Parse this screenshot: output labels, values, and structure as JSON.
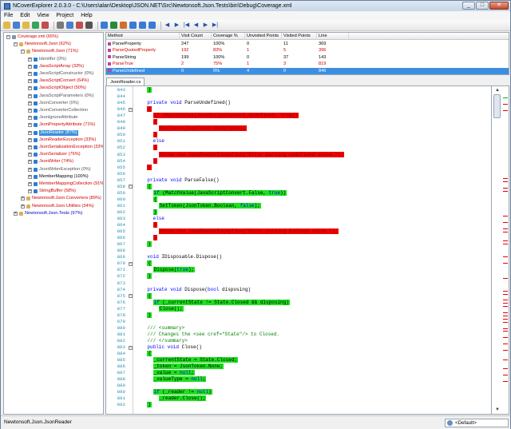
{
  "window": {
    "title": "NCoverExplorer 2.0.3.0 - C:\\Users\\alan\\Desktop\\JSON.NET\\Src\\Newtonsoft.Json.Tests\\bin\\Debug\\Coverage.xml",
    "minimize": "_",
    "maximize": "□",
    "close": "✕"
  },
  "menu": [
    "File",
    "Edit",
    "View",
    "Project",
    "Help"
  ],
  "toolbar": {
    "icons": [
      "open-icon",
      "save-icon",
      "folder-icon",
      "refresh-icon",
      "palette-icon",
      "find-icon",
      "filter-icon",
      "exclude-icon",
      "settings-icon",
      "coverage-icon",
      "report-icon",
      "html-icon",
      "grid-icon",
      "list-icon",
      "tree-icon",
      "back-icon",
      "forward-icon",
      "first-icon",
      "prev-icon",
      "next-icon",
      "last-icon"
    ]
  },
  "tree": [
    {
      "label": "Coverage.xml (65%)",
      "color": "red",
      "icon": "file",
      "level": 0,
      "expander": "−"
    },
    {
      "label": "Newtonsoft.Json (62%)",
      "color": "red",
      "icon": "ns",
      "level": 1,
      "expander": "−"
    },
    {
      "label": "Newtonsoft.Json (71%)",
      "color": "red",
      "icon": "ns",
      "level": 2,
      "expander": "−"
    },
    {
      "label": "IdentIfer (0%)",
      "color": "gray",
      "icon": "cls",
      "level": 3,
      "expander": "+"
    },
    {
      "label": "JavaScriptArray (33%)",
      "color": "red",
      "icon": "cls",
      "level": 3,
      "expander": "+"
    },
    {
      "label": "JavaScriptConstructor (0%)",
      "color": "gray",
      "icon": "cls",
      "level": 3,
      "expander": "+"
    },
    {
      "label": "JavaScriptConvert (64%)",
      "color": "red",
      "icon": "cls",
      "level": 3,
      "expander": "+"
    },
    {
      "label": "JavaScriptObject (50%)",
      "color": "red",
      "icon": "cls",
      "level": 3,
      "expander": "+"
    },
    {
      "label": "JavaScriptParameters (0%)",
      "color": "gray",
      "icon": "cls",
      "level": 3,
      "expander": "+"
    },
    {
      "label": "JsonConverter (0%)",
      "color": "gray",
      "icon": "cls",
      "level": 3,
      "expander": "+"
    },
    {
      "label": "JsonConverterCollection",
      "color": "gray",
      "icon": "cls",
      "level": 3,
      "expander": "+"
    },
    {
      "label": "JsonIgnoreAttribute",
      "color": "gray",
      "icon": "cls",
      "level": 3,
      "expander": "+"
    },
    {
      "label": "JsonPropertyAttribute (71%)",
      "color": "red",
      "icon": "cls",
      "level": 3,
      "expander": "+"
    },
    {
      "label": "JsonReader (87%)",
      "color": "red",
      "icon": "cls",
      "level": 3,
      "expander": "+",
      "selected": true
    },
    {
      "label": "JsonReaderException (33%)",
      "color": "red",
      "icon": "cls",
      "level": 3,
      "expander": "+"
    },
    {
      "label": "JsonSerializationException (33%)",
      "color": "red",
      "icon": "cls",
      "level": 3,
      "expander": "+"
    },
    {
      "label": "JsonSerializer (76%)",
      "color": "red",
      "icon": "cls",
      "level": 3,
      "expander": "+"
    },
    {
      "label": "JsonWriter (74%)",
      "color": "red",
      "icon": "cls",
      "level": 3,
      "expander": "+"
    },
    {
      "label": "JsonWriterException (0%)",
      "color": "gray",
      "icon": "cls",
      "level": 3,
      "expander": "+"
    },
    {
      "label": "MemberMapping (100%)",
      "color": "dark",
      "icon": "cls",
      "level": 3,
      "expander": "+"
    },
    {
      "label": "MemberMappingCollection (91%)",
      "color": "red",
      "icon": "cls",
      "level": 3,
      "expander": "+"
    },
    {
      "label": "StringBuffer (58%)",
      "color": "red",
      "icon": "cls",
      "level": 3,
      "expander": "+"
    },
    {
      "label": "Newtonsoft.Json.Converters (89%)",
      "color": "red",
      "icon": "ns",
      "level": 2,
      "expander": "+"
    },
    {
      "label": "Newtonsoft.Json.Utilities (34%)",
      "color": "red",
      "icon": "ns",
      "level": 2,
      "expander": "+"
    },
    {
      "label": "Newtonsoft.Json.Tests (97%)",
      "color": "blue",
      "icon": "ns",
      "level": 1,
      "expander": "+"
    }
  ],
  "methods": {
    "columns": [
      "Method",
      "Visit Count",
      "Coverage %",
      "Unvisited Points",
      "Visited Points",
      "Line"
    ],
    "rows": [
      {
        "cells": [
          "ParseProperty",
          "247",
          "100%",
          "0",
          "11",
          "369"
        ],
        "color": "dark"
      },
      {
        "cells": [
          "ParseQuotedProperty",
          "192",
          "83%",
          "1",
          "5",
          "396"
        ],
        "color": "red"
      },
      {
        "cells": [
          "ParseString",
          "199",
          "100%",
          "0",
          "37",
          "143"
        ],
        "color": "dark"
      },
      {
        "cells": [
          "ParseTrue",
          "2",
          "75%",
          "1",
          "3",
          "819"
        ],
        "color": "red"
      },
      {
        "cells": [
          "ParseUndefined",
          "0",
          "0%",
          "4",
          "0",
          "846"
        ],
        "color": "dark",
        "selected": true
      }
    ]
  },
  "editor": {
    "tab": "JsonReader.cs",
    "lines": [
      {
        "n": "843",
        "html": "    <span class=\"hl g\">}</span>"
      },
      {
        "n": "844",
        "html": ""
      },
      {
        "n": "845",
        "html": "    <span class=\"kw\">private void</span> ParseUndefined()"
      },
      {
        "n": "846",
        "html": "    <span class=\"hl r\">{</span>",
        "fold": "−"
      },
      {
        "n": "847",
        "html": "      <span class=\"hl r\"><span class=\"kw\">if</span> (MatchValue(JavaScriptConvert.Undefined, <span class=\"kw\">true</span>))</span>"
      },
      {
        "n": "848",
        "html": "      <span class=\"hl r\">{</span>"
      },
      {
        "n": "849",
        "html": "        <span class=\"hl r\">SetToken(JsonToken.Undefined);</span>"
      },
      {
        "n": "850",
        "html": "      <span class=\"hl r\">}</span>"
      },
      {
        "n": "851",
        "html": "      <span class=\"kw\">else</span>"
      },
      {
        "n": "852",
        "html": "      <span class=\"hl r\">{</span>"
      },
      {
        "n": "853",
        "html": "        <span class=\"hl r\"><span class=\"kw\">throw new</span> JsonReaderException(\"Error parsing undefined value.\");</span>"
      },
      {
        "n": "854",
        "html": "      <span class=\"hl r\">}</span>"
      },
      {
        "n": "855",
        "html": "    <span class=\"hl r\">}</span>"
      },
      {
        "n": "856",
        "html": ""
      },
      {
        "n": "857",
        "html": "    <span class=\"kw\">private void</span> ParseFalse()"
      },
      {
        "n": "858",
        "html": "    <span class=\"hl g\">{</span>",
        "fold": "−"
      },
      {
        "n": "859",
        "html": "      <span class=\"hl g\"><span class=\"kw\">if</span> (MatchValue(JavaScriptConvert.False, <span class=\"kw\">true</span>))</span>"
      },
      {
        "n": "860",
        "html": "      <span class=\"hl g\">{</span>"
      },
      {
        "n": "861",
        "html": "        <span class=\"hl g\">SetToken(JsonToken.Boolean, <span class=\"kw\">false</span>);</span>"
      },
      {
        "n": "862",
        "html": "      <span class=\"hl g\">}</span>"
      },
      {
        "n": "863",
        "html": "      <span class=\"kw\">else</span>"
      },
      {
        "n": "864",
        "html": "      <span class=\"hl r\">{</span>"
      },
      {
        "n": "865",
        "html": "        <span class=\"hl r\"><span class=\"kw\">throw new</span> JsonReaderException(\"Error parsing boolean value.\");</span>"
      },
      {
        "n": "866",
        "html": "      <span class=\"hl r\">}</span>"
      },
      {
        "n": "867",
        "html": "    <span class=\"hl g\">}</span>"
      },
      {
        "n": "868",
        "html": ""
      },
      {
        "n": "869",
        "html": "    <span class=\"kw\">void</span> IDisposable.Dispose()"
      },
      {
        "n": "870",
        "html": "    <span class=\"hl g\">{</span>",
        "fold": "−"
      },
      {
        "n": "871",
        "html": "      <span class=\"hl g\">Dispose(<span class=\"kw\">true</span>);</span>"
      },
      {
        "n": "872",
        "html": "    <span class=\"hl g\">}</span>"
      },
      {
        "n": "873",
        "html": ""
      },
      {
        "n": "874",
        "html": "    <span class=\"kw\">private void</span> Dispose(<span class=\"kw\">bool</span> disposing)"
      },
      {
        "n": "875",
        "html": "    <span class=\"hl g\">{</span>",
        "fold": "−"
      },
      {
        "n": "876",
        "html": "      <span class=\"hl g\"><span class=\"kw\">if</span> (_currentState != State.Closed &amp;&amp; disposing)</span>"
      },
      {
        "n": "877",
        "html": "        <span class=\"hl g\">Close();</span>"
      },
      {
        "n": "878",
        "html": "    <span class=\"hl g\">}</span>"
      },
      {
        "n": "879",
        "html": ""
      },
      {
        "n": "880",
        "html": "    <span class=\"cm\">/// &lt;summary&gt;</span>"
      },
      {
        "n": "881",
        "html": "    <span class=\"cm\">/// Changes the &lt;see cref=\"State\"/&gt; to Closed.</span>"
      },
      {
        "n": "882",
        "html": "    <span class=\"cm\">/// &lt;/summary&gt;</span>"
      },
      {
        "n": "883",
        "html": "    <span class=\"kw\">public void</span> Close()",
        "fold": "−"
      },
      {
        "n": "884",
        "html": "    <span class=\"hl g\">{</span>"
      },
      {
        "n": "885",
        "html": "      <span class=\"hl g\">_currentState = State.Closed;</span>"
      },
      {
        "n": "886",
        "html": "      <span class=\"hl g\">_token = JsonToken.None;</span>"
      },
      {
        "n": "887",
        "html": "      <span class=\"hl g\">_value = <span class=\"kw\">null</span>;</span>"
      },
      {
        "n": "888",
        "html": "      <span class=\"hl g\">_valueType = <span class=\"kw\">null</span>;</span>"
      },
      {
        "n": "889",
        "html": ""
      },
      {
        "n": "890",
        "html": "      <span class=\"hl g\"><span class=\"kw\">if</span> (_reader != <span class=\"kw\">null</span>)</span>"
      },
      {
        "n": "891",
        "html": "        <span class=\"hl g\">_reader.Close();</span>"
      },
      {
        "n": "892",
        "html": "    <span class=\"hl g\">}</span>"
      }
    ]
  },
  "scroll_marks": [
    {
      "pos": 0.01,
      "color": "green"
    },
    {
      "pos": 0.03,
      "color": "red"
    },
    {
      "pos": 0.05,
      "color": "red"
    },
    {
      "pos": 0.27,
      "color": "red"
    },
    {
      "pos": 0.28,
      "color": "red"
    },
    {
      "pos": 0.3,
      "color": "red"
    },
    {
      "pos": 0.31,
      "color": "red"
    },
    {
      "pos": 0.39,
      "color": "red"
    },
    {
      "pos": 0.41,
      "color": "red"
    },
    {
      "pos": 0.43,
      "color": "red"
    },
    {
      "pos": 0.44,
      "color": "red"
    },
    {
      "pos": 0.47,
      "color": "red"
    },
    {
      "pos": 0.48,
      "color": "red"
    },
    {
      "pos": 0.52,
      "color": "red"
    },
    {
      "pos": 0.54,
      "color": "red"
    },
    {
      "pos": 0.59,
      "color": "red"
    },
    {
      "pos": 0.63,
      "color": "red"
    },
    {
      "pos": 0.64,
      "color": "red"
    },
    {
      "pos": 0.66,
      "color": "red"
    },
    {
      "pos": 0.67,
      "color": "red"
    },
    {
      "pos": 0.68,
      "color": "red"
    },
    {
      "pos": 0.7,
      "color": "red"
    },
    {
      "pos": 0.71,
      "color": "red"
    },
    {
      "pos": 0.72,
      "color": "red"
    },
    {
      "pos": 0.73,
      "color": "red"
    },
    {
      "pos": 0.75,
      "color": "red"
    },
    {
      "pos": 0.76,
      "color": "red"
    },
    {
      "pos": 0.78,
      "color": "red"
    },
    {
      "pos": 0.8,
      "color": "red"
    },
    {
      "pos": 0.82,
      "color": "red"
    },
    {
      "pos": 0.85,
      "color": "red"
    },
    {
      "pos": 0.88,
      "color": "red"
    },
    {
      "pos": 0.9,
      "color": "red"
    },
    {
      "pos": 0.92,
      "color": "red"
    }
  ],
  "status": {
    "text": "Newtonsoft.Json.JsonReader",
    "theme": "<Default>"
  },
  "colors": {
    "covered": "#1ee01e",
    "uncovered": "#f00000",
    "selection": "#3b8fe0"
  }
}
